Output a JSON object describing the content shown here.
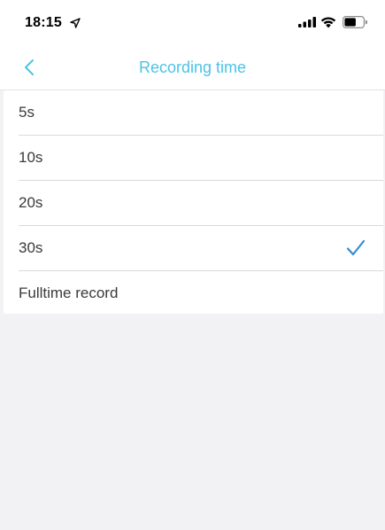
{
  "status_bar": {
    "time": "18:15",
    "icons": [
      "location-arrow-icon",
      "signal-icon",
      "wifi-icon",
      "battery-icon"
    ]
  },
  "nav": {
    "title": "Recording time",
    "back_icon": "chevron-left-icon",
    "accent_color": "#4cc3e6"
  },
  "options": [
    {
      "label": "5s",
      "selected": false
    },
    {
      "label": "10s",
      "selected": false
    },
    {
      "label": "20s",
      "selected": false
    },
    {
      "label": "30s",
      "selected": true
    },
    {
      "label": "Fulltime record",
      "selected": false
    }
  ],
  "check_icon": "checkmark-icon",
  "check_color": "#2f8fd0"
}
